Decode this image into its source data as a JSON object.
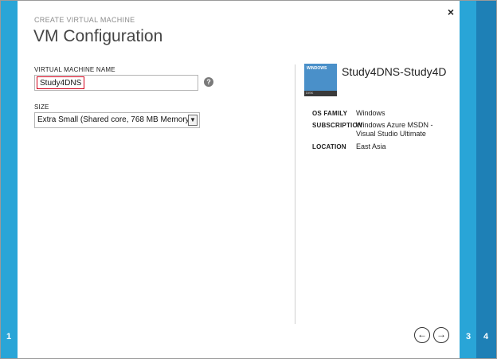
{
  "wizard": {
    "label": "CREATE VIRTUAL MACHINE",
    "title": "VM Configuration"
  },
  "steps": {
    "left": "1",
    "right": [
      "3",
      "4"
    ]
  },
  "form": {
    "name_label": "VIRTUAL MACHINE NAME",
    "name_value": "Study4DNS",
    "help_icon": "?",
    "size_label": "SIZE",
    "size_value": "Extra Small (Shared core, 768 MB Memory)"
  },
  "summary": {
    "image_label": "WINDOWS",
    "image_sub": "DISK",
    "vm_title": "Study4DNS-Study4D...",
    "os_family_label": "OS FAMILY",
    "os_family_value": "Windows",
    "subscription_label": "SUBSCRIPTION",
    "subscription_value": "Windows Azure MSDN - Visual Studio Ultimate",
    "location_label": "LOCATION",
    "location_value": "East Asia"
  },
  "nav": {
    "close": "×",
    "back": "←",
    "next": "→"
  },
  "colors": {
    "strip_light": "#29a5d7",
    "strip_dark": "#1e80b6",
    "highlight": "#d0021b"
  }
}
